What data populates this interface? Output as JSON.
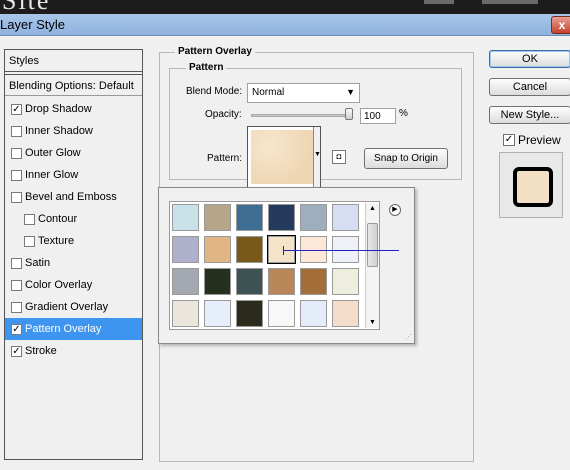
{
  "window": {
    "title": "Layer Style",
    "close_label": "x"
  },
  "background_app": {
    "word": "Site"
  },
  "styles_panel": {
    "header": "Styles",
    "blending": "Blending Options: Default",
    "items": [
      {
        "label": "Drop Shadow",
        "checked": true,
        "selected": false,
        "sub": false
      },
      {
        "label": "Inner Shadow",
        "checked": false,
        "selected": false,
        "sub": false
      },
      {
        "label": "Outer Glow",
        "checked": false,
        "selected": false,
        "sub": false
      },
      {
        "label": "Inner Glow",
        "checked": false,
        "selected": false,
        "sub": false
      },
      {
        "label": "Bevel and Emboss",
        "checked": false,
        "selected": false,
        "sub": false
      },
      {
        "label": "Contour",
        "checked": false,
        "selected": false,
        "sub": true
      },
      {
        "label": "Texture",
        "checked": false,
        "selected": false,
        "sub": true
      },
      {
        "label": "Satin",
        "checked": false,
        "selected": false,
        "sub": false
      },
      {
        "label": "Color Overlay",
        "checked": false,
        "selected": false,
        "sub": false
      },
      {
        "label": "Gradient Overlay",
        "checked": false,
        "selected": false,
        "sub": false
      },
      {
        "label": "Pattern Overlay",
        "checked": true,
        "selected": true,
        "sub": false
      },
      {
        "label": "Stroke",
        "checked": true,
        "selected": false,
        "sub": false
      }
    ]
  },
  "pattern_overlay": {
    "group_title": "Pattern Overlay",
    "subgroup_title": "Pattern",
    "blend_mode_label": "Blend Mode:",
    "blend_mode_value": "Normal",
    "opacity_label": "Opacity:",
    "opacity_value": "100",
    "opacity_unit": "%",
    "opacity_level": 1.0,
    "pattern_label": "Pattern:",
    "snap_button": "Snap to Origin"
  },
  "buttons": {
    "ok": "OK",
    "cancel": "Cancel",
    "new_style": "New Style...",
    "preview_label": "Preview",
    "preview_checked": true
  },
  "pattern_picker": {
    "tiles": [
      "#c9e2ea",
      "#b7a58a",
      "#3e6e94",
      "#243a5c",
      "#9eaebf",
      "#d5def2",
      "#aeb0cc",
      "#e2b584",
      "#7a5a18",
      "#f4e2c9",
      "#fde8d8",
      "#eef2f8",
      "#a4a8b0",
      "#26301e",
      "#3d5252",
      "#b88658",
      "#a46e38",
      "#eeeede",
      "#eae6dc",
      "#e6eefb",
      "#2c2a1c",
      "#f8f8f8",
      "#e4ecfa",
      "#f4dcca"
    ],
    "selected_index": 9
  }
}
